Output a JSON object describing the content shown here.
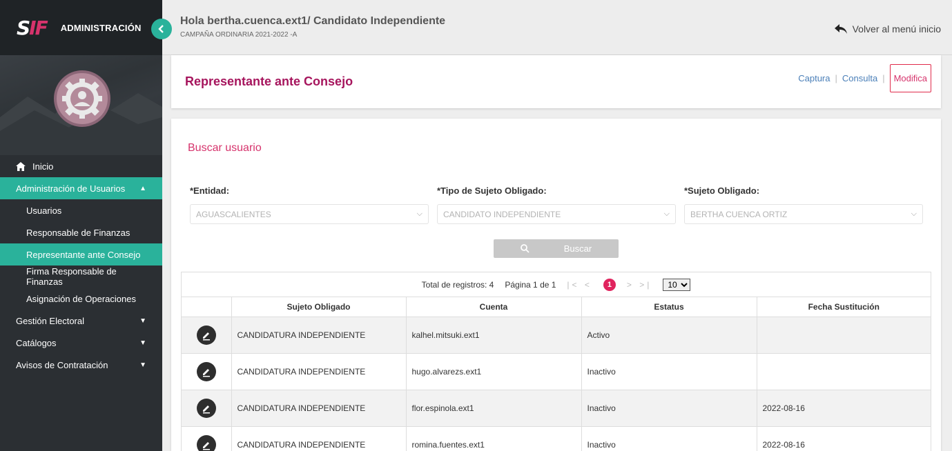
{
  "sidebar": {
    "logo_s": "S",
    "logo_f": "IF",
    "title": "ADMINISTRACIÓN",
    "nav": [
      {
        "label": "Inicio",
        "icon": "home-icon"
      },
      {
        "label": "Administración de Usuarios",
        "expanded": true
      },
      {
        "label": "Usuarios"
      },
      {
        "label": "Responsable de Finanzas"
      },
      {
        "label": "Representante ante Consejo",
        "active": true
      },
      {
        "label": "Firma Responsable de Finanzas"
      },
      {
        "label": "Asignación de Operaciones"
      },
      {
        "label": "Gestión Electoral"
      },
      {
        "label": "Catálogos"
      },
      {
        "label": "Avisos de Contratación"
      }
    ]
  },
  "header": {
    "greeting": "Hola bertha.cuenca.ext1/ Candidato Independiente",
    "campaign": "CAMPAÑA ORDINARIA 2021-2022 -A",
    "back_label": "Volver al menú inicio"
  },
  "title_card": {
    "title": "Representante ante Consejo",
    "actions": [
      "Captura",
      "Consulta",
      "Modifica"
    ],
    "selected_action": "Modifica"
  },
  "search": {
    "title": "Buscar usuario",
    "fields": [
      {
        "label": "*Entidad:",
        "value": "AGUASCALIENTES"
      },
      {
        "label": "*Tipo de Sujeto Obligado:",
        "value": "CANDIDATO INDEPENDIENTE"
      },
      {
        "label": "*Sujeto Obligado:",
        "value": "BERTHA CUENCA ORTIZ"
      }
    ],
    "button_label": "Buscar"
  },
  "pager": {
    "total": "Total de registros: 4",
    "page": "Página 1 de 1",
    "current": "1",
    "page_size": "10"
  },
  "table": {
    "headers": [
      "",
      "Sujeto Obligado",
      "Cuenta",
      "Estatus",
      "Fecha Sustitución"
    ],
    "rows": [
      {
        "sujeto": "CANDIDATURA INDEPENDIENTE",
        "cuenta": "kalhel.mitsuki.ext1",
        "estatus": "Activo",
        "fecha": ""
      },
      {
        "sujeto": "CANDIDATURA INDEPENDIENTE",
        "cuenta": "hugo.alvarezs.ext1",
        "estatus": "Inactivo",
        "fecha": ""
      },
      {
        "sujeto": "CANDIDATURA INDEPENDIENTE",
        "cuenta": "flor.espinola.ext1",
        "estatus": "Inactivo",
        "fecha": "2022-08-16"
      },
      {
        "sujeto": "CANDIDATURA INDEPENDIENTE",
        "cuenta": "romina.fuentes.ext1",
        "estatus": "Inactivo",
        "fecha": "2022-08-16"
      }
    ]
  },
  "colors": {
    "accent": "#2ab29b",
    "brand": "#a6155d",
    "sidebar_bg": "#2b2f33",
    "link": "#4a7fb8"
  }
}
